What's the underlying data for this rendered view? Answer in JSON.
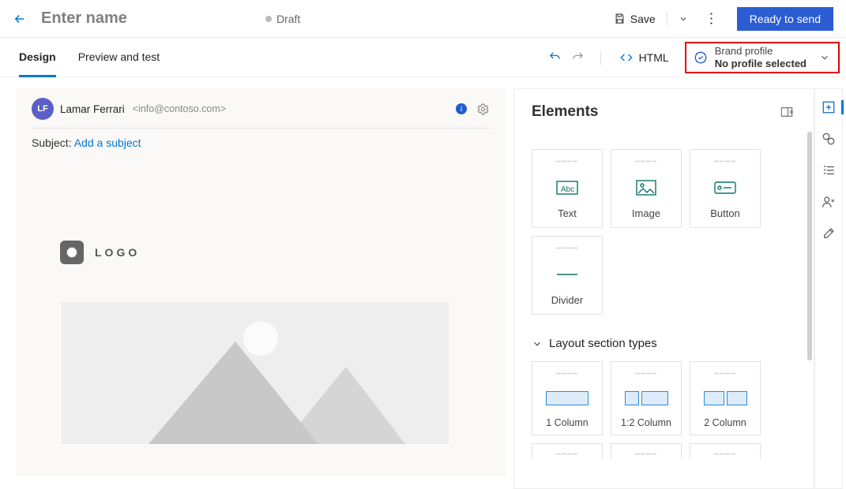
{
  "header": {
    "title_placeholder": "Enter name",
    "status": "Draft",
    "save_label": "Save",
    "ready_label": "Ready to send"
  },
  "tabs": {
    "design": "Design",
    "preview": "Preview and test",
    "html": "HTML"
  },
  "brand": {
    "line1": "Brand profile",
    "line2": "No profile selected"
  },
  "email": {
    "avatar_initials": "LF",
    "from_name": "Lamar Ferrari",
    "from_email": "<info@contoso.com>",
    "subject_label": "Subject:",
    "subject_link": "Add a subject",
    "logo_text": "LOGO"
  },
  "elements": {
    "title": "Elements",
    "cards": {
      "text": "Text",
      "image": "Image",
      "button": "Button",
      "divider": "Divider"
    }
  },
  "layouts": {
    "title": "Layout section types",
    "c1": "1 Column",
    "c12": "1:2 Column",
    "c2": "2 Column"
  }
}
